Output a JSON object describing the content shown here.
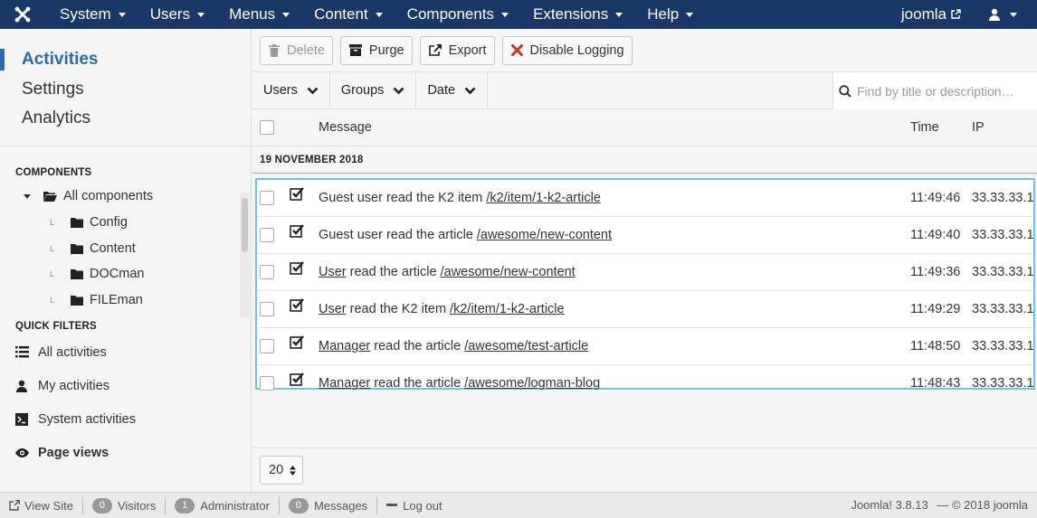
{
  "topbar": {
    "menu": [
      "System",
      "Users",
      "Menus",
      "Content",
      "Components",
      "Extensions",
      "Help"
    ],
    "site_name": "joomla"
  },
  "sidebar": {
    "nav": [
      "Activities",
      "Settings",
      "Analytics"
    ],
    "components_title": "COMPONENTS",
    "tree_root": "All components",
    "tree_children": [
      "Config",
      "Content",
      "DOCman",
      "FILEman"
    ],
    "quick_filters_title": "QUICK FILTERS",
    "quick_filters": [
      "All activities",
      "My activities",
      "System activities",
      "Page views"
    ]
  },
  "toolbar": {
    "delete": "Delete",
    "purge": "Purge",
    "export": "Export",
    "disable_logging": "Disable Logging"
  },
  "filters": {
    "users": "Users",
    "groups": "Groups",
    "date": "Date",
    "search_placeholder": "Find by title or description…"
  },
  "table": {
    "col_message": "Message",
    "col_time": "Time",
    "col_ip": "IP",
    "group_title": "19 NOVEMBER 2018",
    "rows": [
      {
        "actor": "Guest user",
        "action": " read the K2 item ",
        "link": "/k2/item/1-k2-article",
        "time": "11:49:46",
        "ip": "33.33.33.1"
      },
      {
        "actor": "Guest user",
        "action": " read the article ",
        "link": "/awesome/new-content",
        "time": "11:49:40",
        "ip": "33.33.33.1"
      },
      {
        "actor": "User",
        "action": " read the article ",
        "link": "/awesome/new-content",
        "time": "11:49:36",
        "ip": "33.33.33.1"
      },
      {
        "actor": "User",
        "action": " read the K2 item ",
        "link": "/k2/item/1-k2-article",
        "time": "11:49:29",
        "ip": "33.33.33.1"
      },
      {
        "actor": "Manager",
        "action": " read the article ",
        "link": "/awesome/test-article",
        "time": "11:48:50",
        "ip": "33.33.33.1"
      },
      {
        "actor": "Manager",
        "action": " read the article ",
        "link": "/awesome/logman-blog",
        "time": "11:48:43",
        "ip": "33.33.33.1"
      }
    ]
  },
  "pager": {
    "limit": "20"
  },
  "statusbar": {
    "view_site": "View Site",
    "visitors_count": "0",
    "visitors_label": "Visitors",
    "admin_count": "1",
    "admin_label": "Administrator",
    "messages_count": "0",
    "messages_label": "Messages",
    "logout": "Log out",
    "version": "Joomla! 3.8.13",
    "copyright": "— © 2018 joomla"
  }
}
